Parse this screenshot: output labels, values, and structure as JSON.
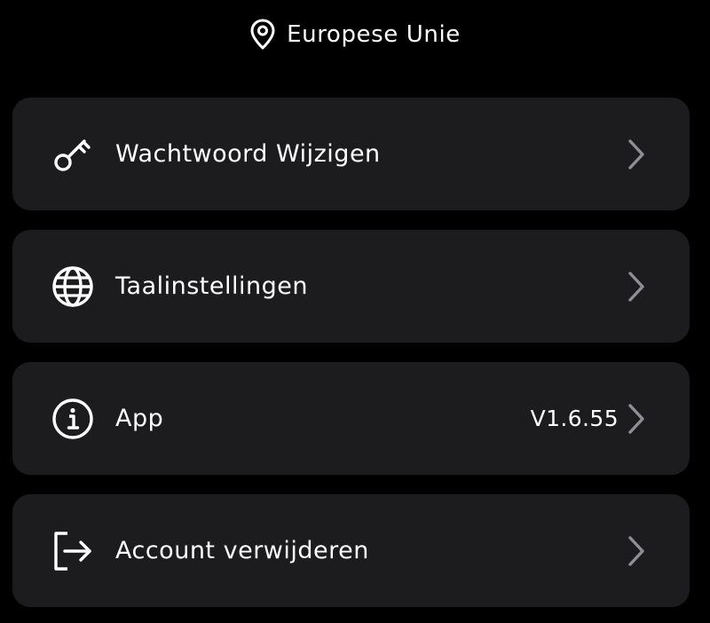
{
  "header": {
    "region_icon": "location-pin-icon",
    "region_label": "Europese Unie"
  },
  "menu": {
    "items": [
      {
        "icon": "key-icon",
        "label": "Wachtwoord Wijzigen",
        "value": ""
      },
      {
        "icon": "globe-icon",
        "label": "Taalinstellingen",
        "value": ""
      },
      {
        "icon": "info-icon",
        "label": "App",
        "value": "V1.6.55"
      },
      {
        "icon": "logout-icon",
        "label": "Account verwijderen",
        "value": ""
      }
    ]
  },
  "colors": {
    "background": "#000000",
    "card": "#1c1c1e",
    "text": "#ffffff",
    "chevron": "#8e8e93"
  }
}
